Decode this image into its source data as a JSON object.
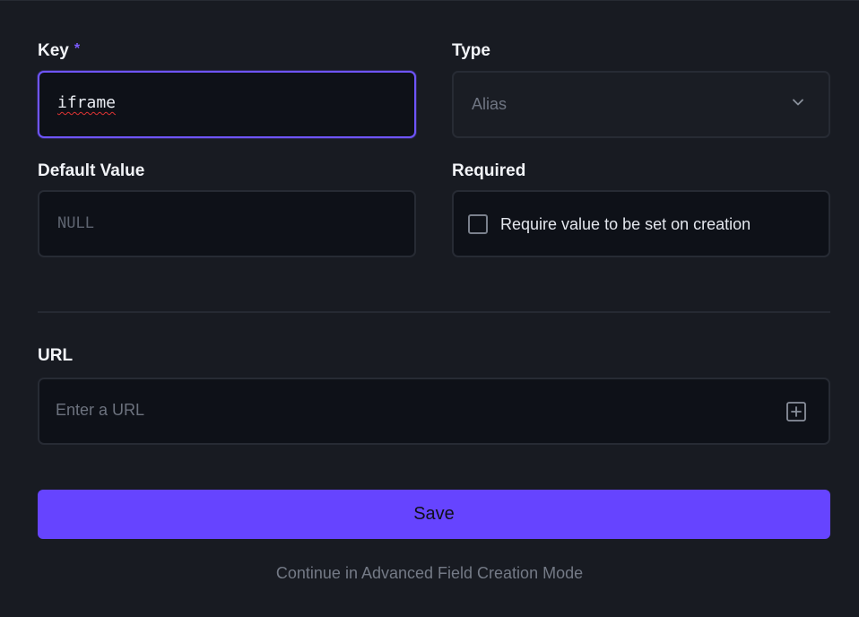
{
  "key_field": {
    "label": "Key",
    "required_marker": "*",
    "value": "iframe"
  },
  "type_field": {
    "label": "Type",
    "selected": "Alias",
    "icon": "chevron-down-icon"
  },
  "default_value_field": {
    "label": "Default Value",
    "placeholder": "NULL"
  },
  "required_field": {
    "label": "Required",
    "checkbox_label": "Require value to be set on creation",
    "checked": false
  },
  "url_field": {
    "label": "URL",
    "placeholder": "Enter a URL",
    "icon": "add-square-icon"
  },
  "actions": {
    "save_label": "Save",
    "advanced_link": "Continue in Advanced Field Creation Mode"
  },
  "colors": {
    "background": "#181b22",
    "input_background": "#0e1118",
    "accent": "#6644ff",
    "focus_border": "#6f55ff",
    "required_star": "#7c5cff"
  }
}
